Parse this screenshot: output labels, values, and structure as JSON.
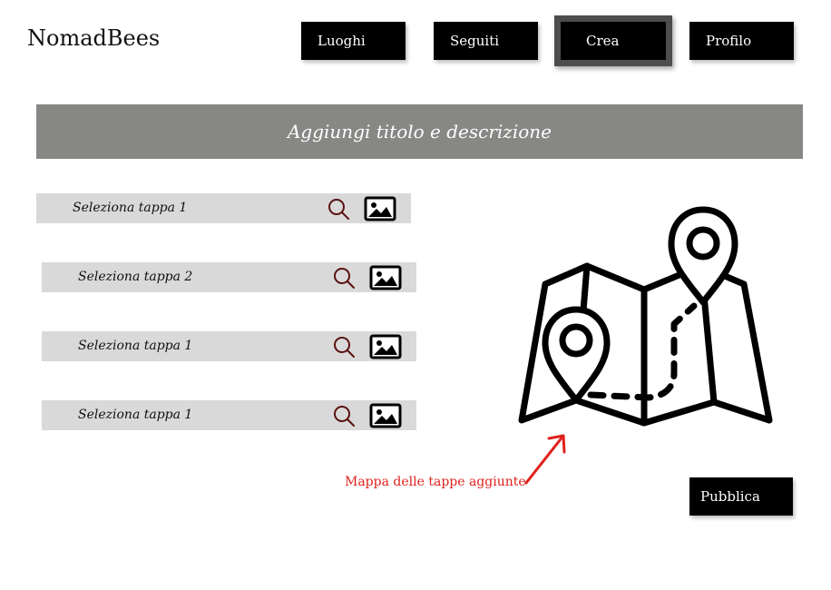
{
  "brand": {
    "name": "NomadBees"
  },
  "nav": {
    "luoghi": "Luoghi",
    "seguiti": "Seguiti",
    "crea": "Crea",
    "profilo": "Profilo",
    "active": "crea"
  },
  "title_bar": {
    "placeholder": "Aggiungi titolo e descrizione"
  },
  "stages": [
    {
      "label": "Seleziona tappa 1",
      "search_icon": "search-icon",
      "image_icon": "image-icon"
    },
    {
      "label": "Seleziona tappa 2",
      "search_icon": "search-icon",
      "image_icon": "image-icon"
    },
    {
      "label": "Seleziona tappa 1",
      "search_icon": "search-icon",
      "image_icon": "image-icon"
    },
    {
      "label": "Seleziona tappa 1",
      "search_icon": "search-icon",
      "image_icon": "image-icon"
    }
  ],
  "map": {
    "icon": "map-with-pins-icon"
  },
  "annotation": {
    "text": "Mappa delle tappe aggiunte",
    "arrow_icon": "arrow-up-right-icon"
  },
  "actions": {
    "publish": "Pubblica"
  },
  "colors": {
    "nav_bg": "#000000",
    "nav_active_frame": "#4d4d4d",
    "title_bar_bg": "#878785",
    "stage_row_bg": "#d9d9d9",
    "search_icon": "#5a1010",
    "annotation": "#e0201b"
  }
}
